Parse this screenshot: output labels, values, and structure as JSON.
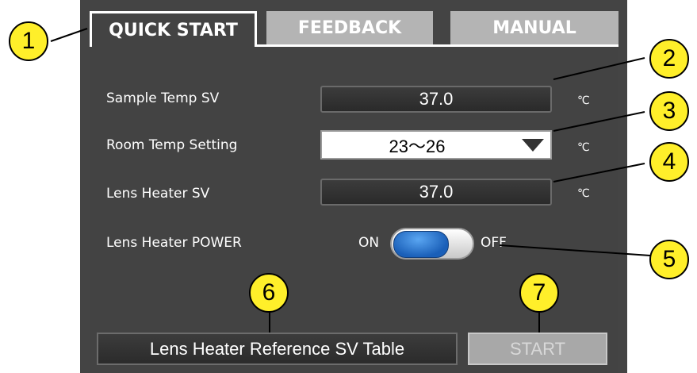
{
  "tabs": [
    {
      "label": "QUICK START",
      "active": true
    },
    {
      "label": "FEEDBACK",
      "active": false
    },
    {
      "label": "MANUAL",
      "active": false
    }
  ],
  "settings": {
    "sample_temp": {
      "label": "Sample Temp  SV",
      "value": "37.0",
      "unit": "℃"
    },
    "room_temp": {
      "label": "Room Temp Setting",
      "value": "23～26",
      "unit": "℃"
    },
    "lens_heater_sv": {
      "label": "Lens Heater  SV",
      "value": "37.0",
      "unit": "℃"
    },
    "lens_heater_power": {
      "label": "Lens Heater  POWER",
      "on_label": "ON",
      "off_label": "OFF",
      "state": "ON"
    }
  },
  "buttons": {
    "reference_table": "Lens Heater Reference SV Table",
    "start": "START"
  },
  "callouts": [
    "1",
    "2",
    "3",
    "4",
    "5",
    "6",
    "7"
  ],
  "colors": {
    "callout": "#ffef2a",
    "panel": "#434343",
    "toggle_knob": "#1a5fb8",
    "start_disabled": "#a8a8a8"
  }
}
